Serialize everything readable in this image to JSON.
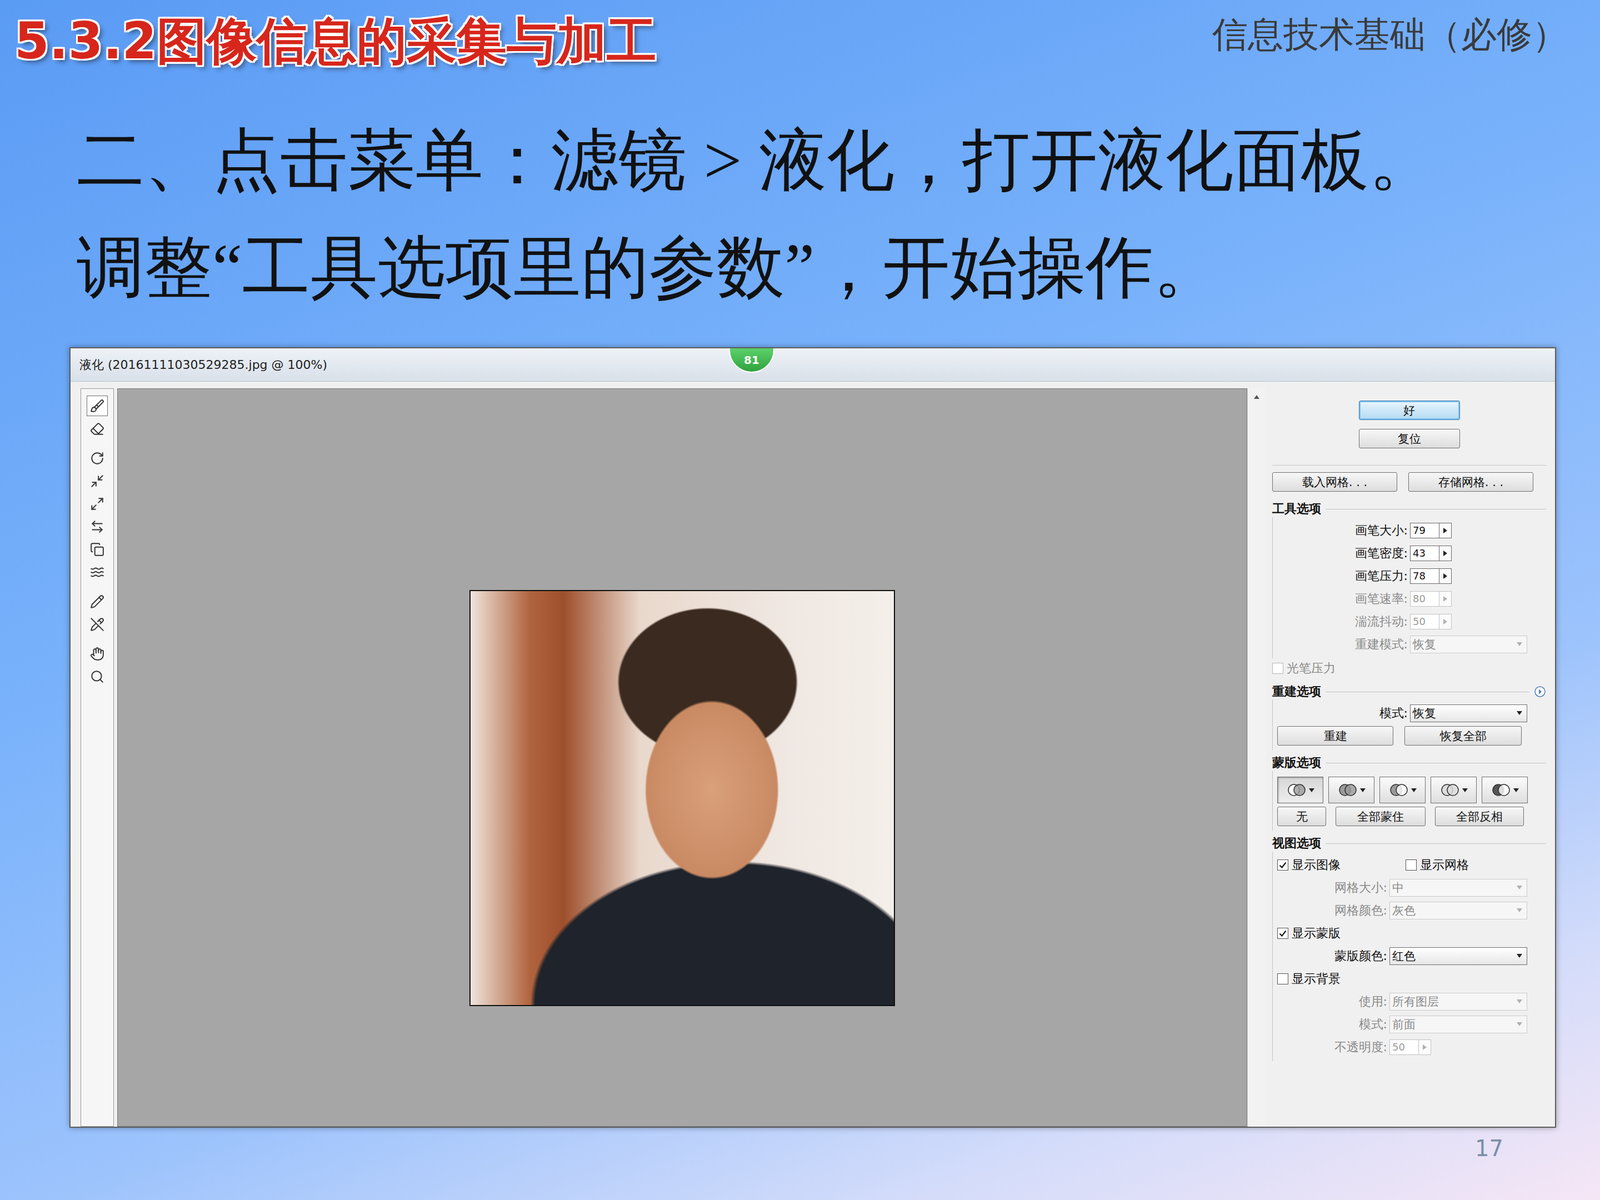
{
  "slide": {
    "section_title": "5.3.2图像信息的采集与加工",
    "course": "信息技术基础（必修）",
    "heading_lines": [
      "二、点击菜单：滤镜 > 液化，打开液化面板。",
      "调整“工具选项里的参数”，开始操作。"
    ],
    "page_number": "17"
  },
  "window": {
    "title": "液化 (20161111030529285.jpg @ 100%)",
    "badge": "81"
  },
  "tool_groups": [
    [
      {
        "kind": "forward-warp",
        "selected": true
      },
      {
        "kind": "reconstruct",
        "selected": false
      }
    ],
    [
      {
        "kind": "twirl",
        "selected": false
      },
      {
        "kind": "pucker",
        "selected": false
      },
      {
        "kind": "bloat",
        "selected": false
      },
      {
        "kind": "push-left",
        "selected": false
      },
      {
        "kind": "mirror",
        "selected": false
      },
      {
        "kind": "turbulence",
        "selected": false
      }
    ],
    [
      {
        "kind": "freeze-mask",
        "selected": false
      },
      {
        "kind": "thaw-mask",
        "selected": false
      }
    ],
    [
      {
        "kind": "hand",
        "selected": false
      },
      {
        "kind": "zoom",
        "selected": false
      }
    ]
  ],
  "dialog_buttons": [
    {
      "label": "好",
      "default": true
    },
    {
      "label": "复位",
      "default": false
    }
  ],
  "mesh_buttons": [
    "载入网格. . .",
    "存储网格. . ."
  ],
  "tool_options": {
    "title": "工具选项",
    "fields": [
      {
        "kind": "number",
        "label": "画笔大小:",
        "value": "79",
        "disabled": false
      },
      {
        "kind": "number",
        "label": "画笔密度:",
        "value": "43",
        "disabled": false
      },
      {
        "kind": "number",
        "label": "画笔压力:",
        "value": "78",
        "disabled": false
      },
      {
        "kind": "number",
        "label": "画笔速率:",
        "value": "80",
        "disabled": true
      },
      {
        "kind": "number",
        "label": "湍流抖动:",
        "value": "50",
        "disabled": true
      },
      {
        "kind": "select",
        "label": "重建模式:",
        "value": "恢复",
        "disabled": true
      }
    ],
    "stylus": {
      "label": "光笔压力",
      "checked": false,
      "disabled": true
    }
  },
  "reconstruct_options": {
    "title": "重建选项",
    "mode": {
      "label": "模式:",
      "value": "恢复",
      "disabled": false
    },
    "buttons": [
      "重建",
      "恢复全部"
    ]
  },
  "mask_options": {
    "title": "蒙版选项",
    "modes": [
      {
        "kind": "replace",
        "selected": true
      },
      {
        "kind": "add",
        "selected": false
      },
      {
        "kind": "subtract",
        "selected": false
      },
      {
        "kind": "intersect",
        "selected": false
      },
      {
        "kind": "invert",
        "selected": false
      }
    ],
    "buttons": [
      "无",
      "全部蒙住",
      "全部反相"
    ]
  },
  "view_options": {
    "title": "视图选项",
    "rows": [
      {
        "kind": "checkbox-pair",
        "items": [
          {
            "label": "显示图像",
            "checked": true
          },
          {
            "label": "显示网格",
            "checked": false
          }
        ]
      },
      {
        "kind": "select",
        "label": "网格大小:",
        "value": "中",
        "disabled": true
      },
      {
        "kind": "select",
        "label": "网格颜色:",
        "value": "灰色",
        "disabled": true
      },
      {
        "kind": "checkbox",
        "label": "显示蒙版",
        "checked": true
      },
      {
        "kind": "select",
        "label": "蒙版颜色:",
        "value": "红色",
        "disabled": false
      },
      {
        "kind": "checkbox",
        "label": "显示背景",
        "checked": false
      },
      {
        "kind": "select",
        "label": "使用:",
        "value": "所有图层",
        "disabled": true
      },
      {
        "kind": "select",
        "label": "模式:",
        "value": "前面",
        "disabled": true
      },
      {
        "kind": "number",
        "label": "不透明度:",
        "value": "50",
        "disabled": true
      }
    ]
  }
}
